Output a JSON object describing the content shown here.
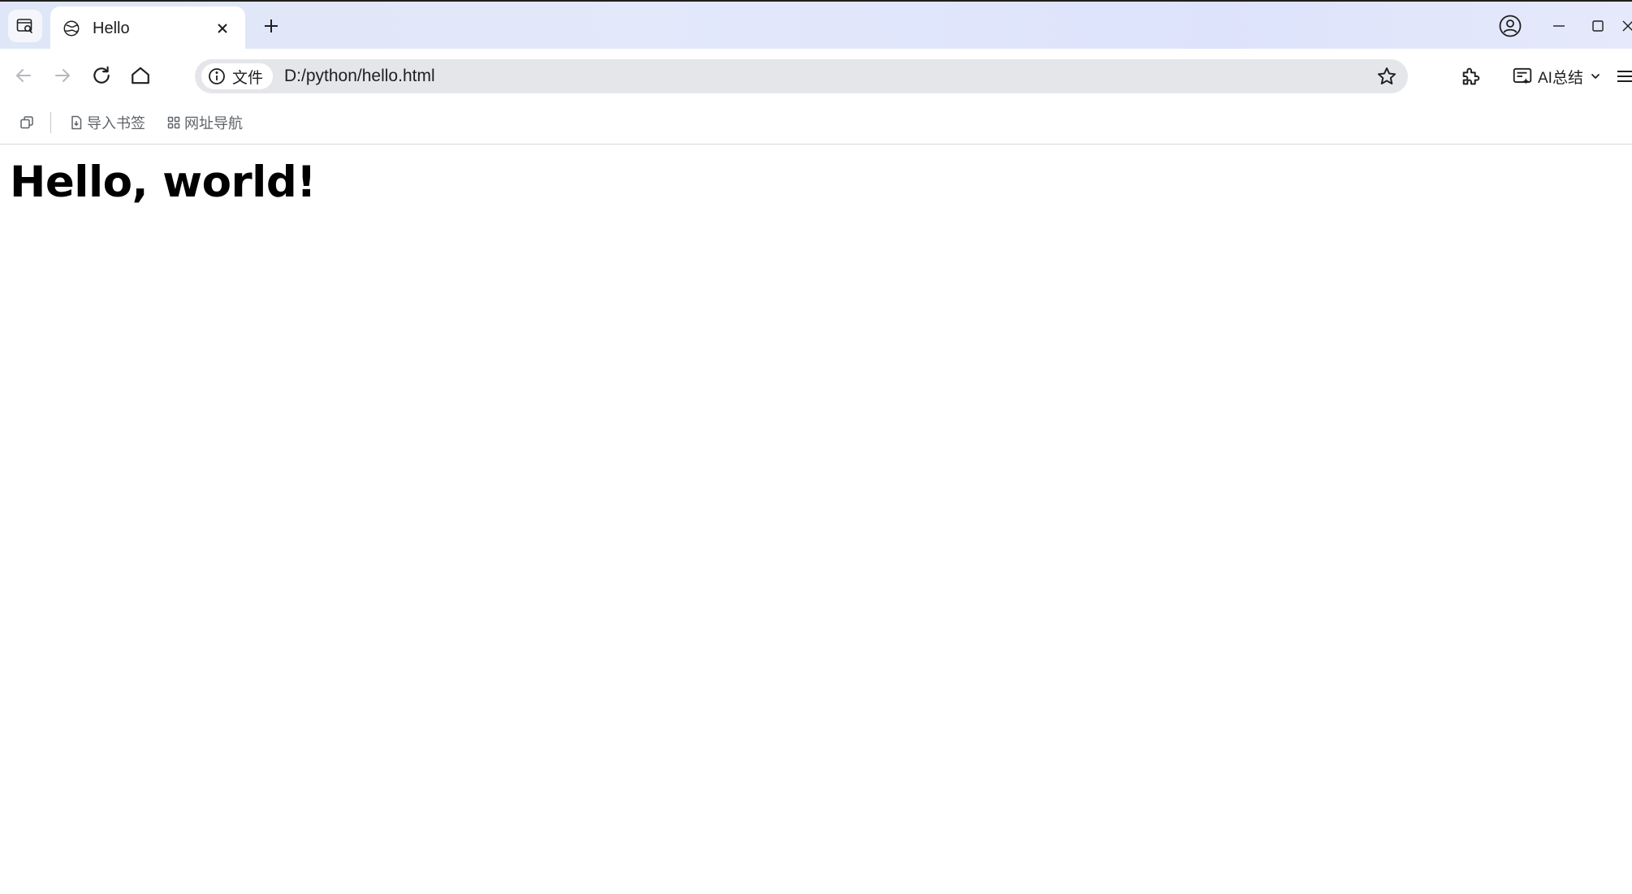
{
  "tab": {
    "title": "Hello",
    "favicon": "globe-icon"
  },
  "omnibox": {
    "chip_label": "文件",
    "url": "D:/python/hello.html"
  },
  "toolbar": {
    "ai_label": "AI总结"
  },
  "bookmarks": {
    "items": [
      {
        "label": "导入书签",
        "icon": "import-bookmark-icon"
      },
      {
        "label": "网址导航",
        "icon": "grid-icon"
      }
    ]
  },
  "page": {
    "heading": "Hello, world!"
  },
  "colors": {
    "tabstrip": "#dfe6f7",
    "omnibox_bg": "#e5e6ea",
    "icon_active": "#1f1f1f",
    "icon_disabled": "#b5b8be"
  }
}
